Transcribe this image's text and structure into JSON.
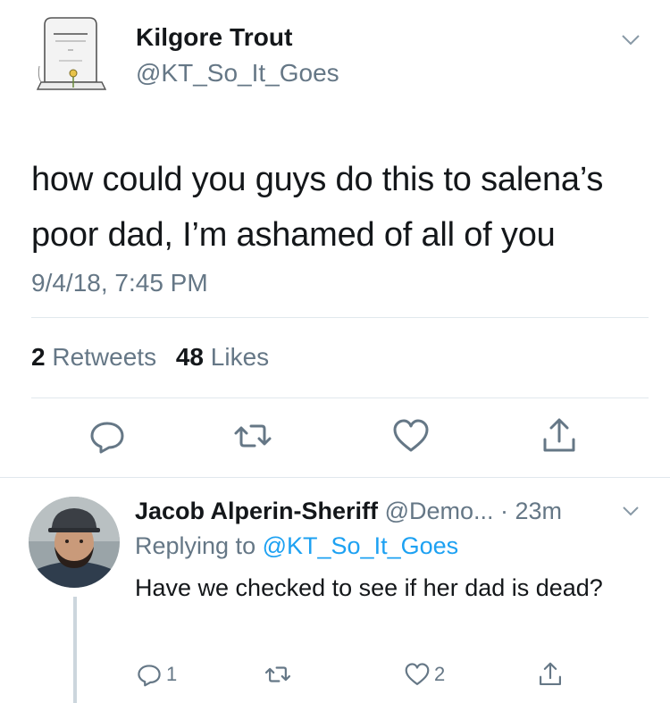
{
  "tweet": {
    "author_name": "Kilgore Trout",
    "author_handle": "@KT_So_It_Goes",
    "avatar_icon": "gravestone-avatar-icon",
    "text": "how could you guys do this to salena’s poor dad, I’m ashamed of all of you",
    "timestamp": "9/4/18, 7:45 PM",
    "retweets_count": "2",
    "retweets_label": "Retweets",
    "likes_count": "48",
    "likes_label": "Likes"
  },
  "actions": [
    "reply-icon",
    "retweet-icon",
    "like-icon",
    "share-icon"
  ],
  "reply": {
    "author_name": "Jacob Alperin-Sheriff",
    "author_handle": "@Demo...",
    "time": "· 23m",
    "replying_prefix": "Replying to",
    "replying_handle": "@KT_So_It_Goes",
    "text": "Have we checked to see if her dad is dead?",
    "reply_count": "1",
    "retweet_count": "",
    "like_count": "2"
  },
  "colors": {
    "text": "#14171a",
    "muted": "#657786",
    "link": "#1da1f2",
    "divider": "#e1e8ed",
    "thread_line": "#ccd6dd"
  }
}
